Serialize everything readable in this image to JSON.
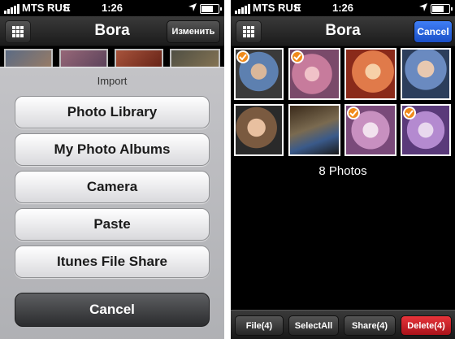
{
  "left": {
    "status": {
      "carrier": "MTS RUS",
      "network": "E",
      "time": "1:26"
    },
    "nav": {
      "title": "Bora",
      "edit_label": "Изменить"
    },
    "sheet": {
      "title": "Import",
      "buttons": [
        "Photo Library",
        "My Photo Albums",
        "Camera",
        "Paste",
        "Itunes File Share"
      ],
      "cancel_label": "Cancel"
    }
  },
  "right": {
    "status": {
      "carrier": "MTS RUS",
      "network": "E",
      "time": "1:26"
    },
    "nav": {
      "title": "Bora",
      "cancel_label": "Cancel"
    },
    "photo_count_label": "8 Photos",
    "toolbar": {
      "file_label": "File(4)",
      "selectall_label": "SelectAll",
      "share_label": "Share(4)",
      "delete_label": "Delete(4)"
    }
  },
  "colors": {
    "accent_blue": "#1a5fe0",
    "delete_red": "#c8161c",
    "check_orange": "#f08a1a"
  },
  "icons": [
    "signal-icon",
    "location-arrow-icon",
    "battery-icon",
    "grid-icon",
    "checkmark-icon"
  ]
}
